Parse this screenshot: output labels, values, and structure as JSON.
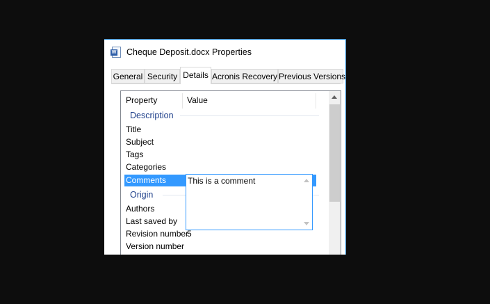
{
  "window": {
    "title": "Cheque Deposit.docx Properties"
  },
  "tabs": [
    "General",
    "Security",
    "Details",
    "Acronis Recovery",
    "Previous Versions"
  ],
  "active_tab": "Details",
  "columns": {
    "property": "Property",
    "value": "Value"
  },
  "groups": {
    "description": "Description",
    "origin": "Origin"
  },
  "description_props": [
    "Title",
    "Subject",
    "Tags",
    "Categories",
    "Comments"
  ],
  "origin_props": [
    "Authors",
    "Last saved by",
    "Revision number",
    "Version number"
  ],
  "values": {
    "comments": "This is a comment",
    "revision_number": "5"
  },
  "icons": {
    "window": "word-document-icon"
  },
  "colors": {
    "selection": "#3399ff",
    "group_header": "#1e3f8a",
    "window_border": "#2b8cd6"
  }
}
